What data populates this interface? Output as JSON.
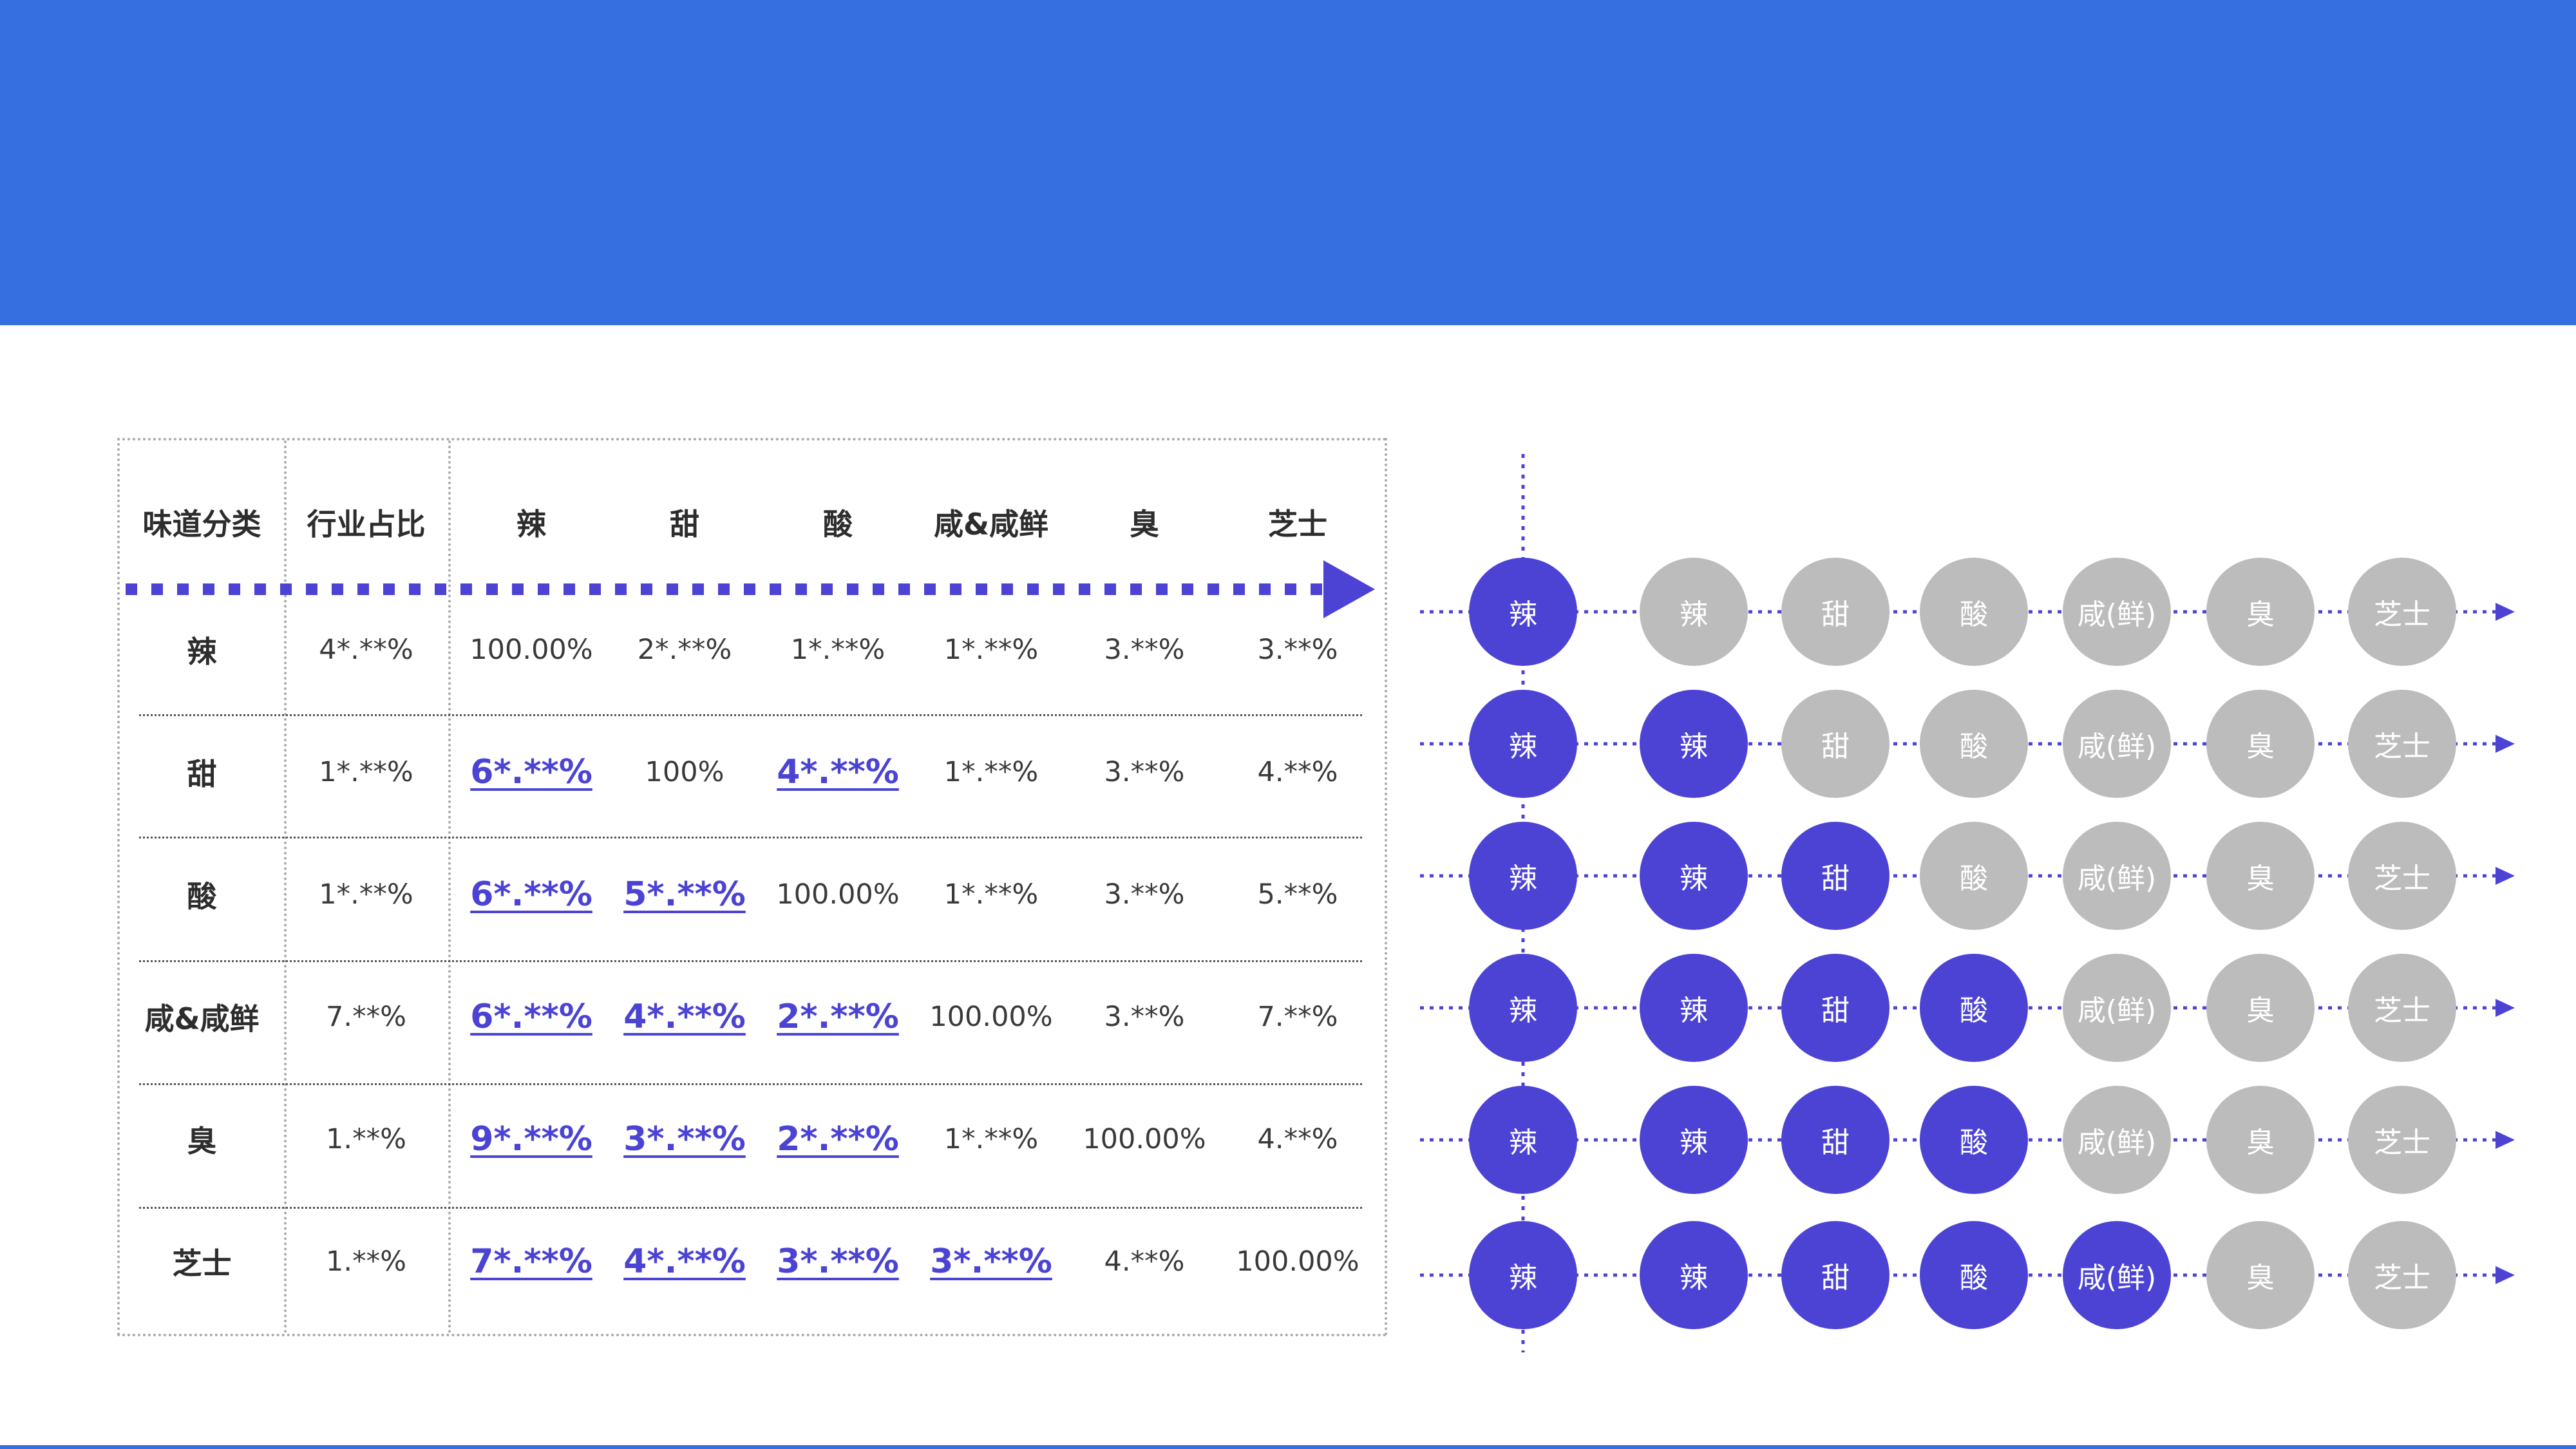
{
  "colors": {
    "header": "#3670e0",
    "accent": "#4c43d4",
    "inactive": "#bcbcbc",
    "border": "#a9a9a9"
  },
  "table": {
    "corner_header": [
      "味道",
      "分类"
    ],
    "share_header": [
      "行业",
      "占比"
    ],
    "columns": [
      "辣",
      "甜",
      "酸",
      "咸&咸鲜",
      "臭",
      "芝士"
    ],
    "rows": [
      {
        "label": "辣",
        "share": "4*.**%",
        "values": [
          "100.00%",
          "2*.**%",
          "1*.**%",
          "1*.**%",
          "3.**%",
          "3.**%"
        ],
        "highlight": [
          false,
          false,
          false,
          false,
          false,
          false
        ]
      },
      {
        "label": "甜",
        "share": "1*.**%",
        "values": [
          "6*.**%",
          "100%",
          "4*.**%",
          "1*.**%",
          "3.**%",
          "4.**%"
        ],
        "highlight": [
          true,
          false,
          true,
          false,
          false,
          false
        ]
      },
      {
        "label": "酸",
        "share": "1*.**%",
        "values": [
          "6*.**%",
          "5*.**%",
          "100.00%",
          "1*.**%",
          "3.**%",
          "5.**%"
        ],
        "highlight": [
          true,
          true,
          false,
          false,
          false,
          false
        ]
      },
      {
        "label": "咸&咸鲜",
        "share": "7.**%",
        "values": [
          "6*.**%",
          "4*.**%",
          "2*.**%",
          "100.00%",
          "3.**%",
          "7.**%"
        ],
        "highlight": [
          true,
          true,
          true,
          false,
          false,
          false
        ]
      },
      {
        "label": "臭",
        "share": "1.**%",
        "values": [
          "9*.**%",
          "3*.**%",
          "2*.**%",
          "1*.**%",
          "100.00%",
          "4.**%"
        ],
        "highlight": [
          true,
          true,
          true,
          false,
          false,
          false
        ]
      },
      {
        "label": "芝士",
        "share": "1.**%",
        "values": [
          "7*.**%",
          "4*.**%",
          "3*.**%",
          "3*.**%",
          "4.**%",
          "100.00%"
        ],
        "highlight": [
          true,
          true,
          true,
          true,
          false,
          false
        ]
      }
    ]
  },
  "flow": {
    "start_label": "辣",
    "nodes": [
      "辣",
      "甜",
      "酸",
      "咸(鲜)",
      "臭",
      "芝士"
    ],
    "active_counts": [
      0,
      1,
      2,
      3,
      3,
      4
    ]
  }
}
